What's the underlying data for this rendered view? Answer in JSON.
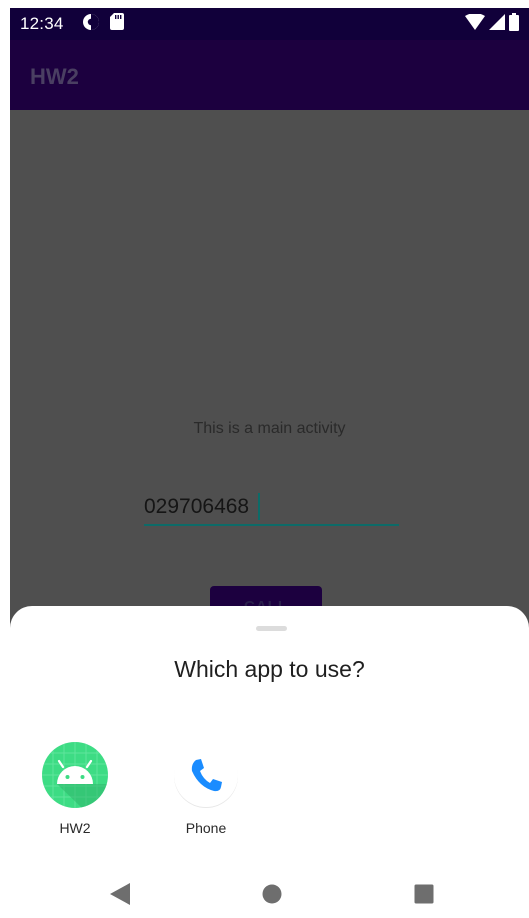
{
  "status_bar": {
    "time": "12:34",
    "icons": [
      "data-saver-icon",
      "sd-card-icon",
      "wifi-icon",
      "cell-signal-icon",
      "battery-icon"
    ]
  },
  "app_bar": {
    "title": "HW2"
  },
  "main": {
    "description": "This is a main activity",
    "phone_input": {
      "value": "029706468"
    },
    "call_button": {
      "label": "CALL"
    }
  },
  "chooser": {
    "title": "Which app to use?",
    "apps": [
      {
        "label": "HW2",
        "icon": "android-icon"
      },
      {
        "label": "Phone",
        "icon": "phone-icon"
      }
    ]
  },
  "nav_bar": {
    "icons": [
      "back-icon",
      "home-icon",
      "recents-icon"
    ]
  },
  "colors": {
    "status_bar": "#11003a",
    "app_bar": "#1c003f",
    "scrim_content": "#4f4f4f",
    "input_underline": "#0d6b68",
    "android_green": "#3ddc84",
    "phone_blue": "#1a8cff"
  }
}
